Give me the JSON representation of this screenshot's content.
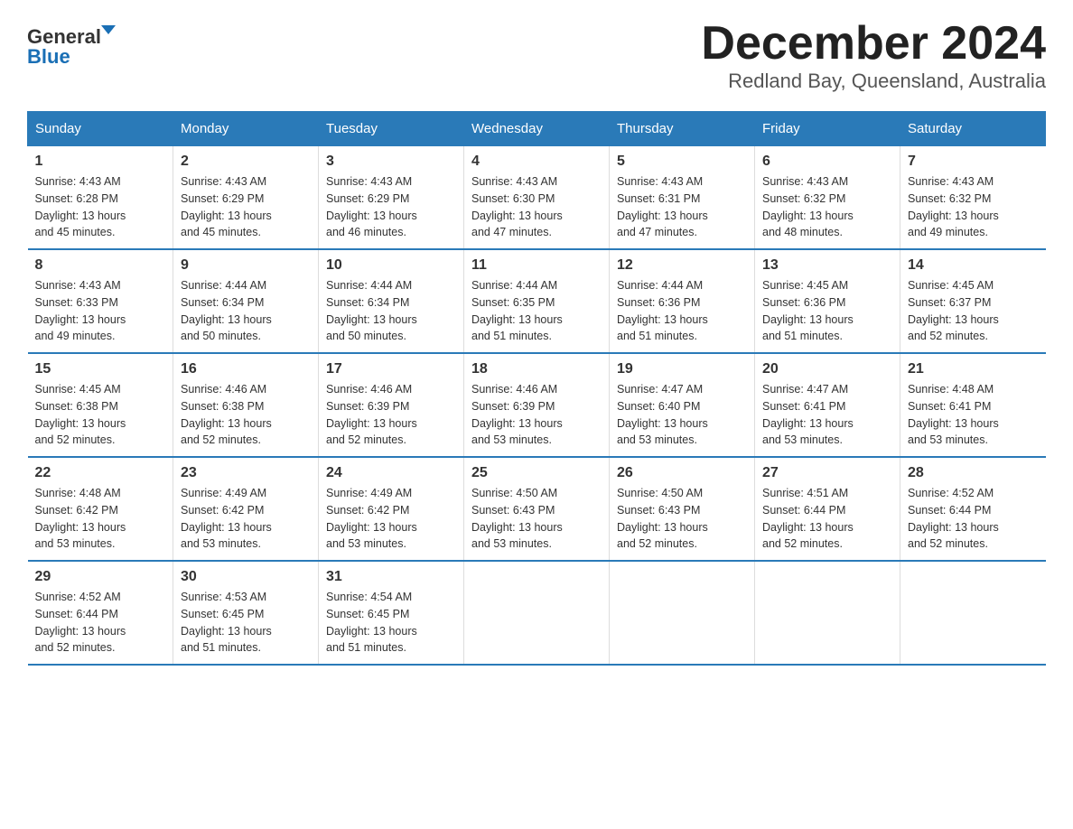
{
  "logo": {
    "general": "General",
    "blue": "Blue"
  },
  "title": "December 2024",
  "subtitle": "Redland Bay, Queensland, Australia",
  "headers": [
    "Sunday",
    "Monday",
    "Tuesday",
    "Wednesday",
    "Thursday",
    "Friday",
    "Saturday"
  ],
  "weeks": [
    [
      {
        "day": "1",
        "sunrise": "4:43 AM",
        "sunset": "6:28 PM",
        "daylight": "13 hours and 45 minutes."
      },
      {
        "day": "2",
        "sunrise": "4:43 AM",
        "sunset": "6:29 PM",
        "daylight": "13 hours and 45 minutes."
      },
      {
        "day": "3",
        "sunrise": "4:43 AM",
        "sunset": "6:29 PM",
        "daylight": "13 hours and 46 minutes."
      },
      {
        "day": "4",
        "sunrise": "4:43 AM",
        "sunset": "6:30 PM",
        "daylight": "13 hours and 47 minutes."
      },
      {
        "day": "5",
        "sunrise": "4:43 AM",
        "sunset": "6:31 PM",
        "daylight": "13 hours and 47 minutes."
      },
      {
        "day": "6",
        "sunrise": "4:43 AM",
        "sunset": "6:32 PM",
        "daylight": "13 hours and 48 minutes."
      },
      {
        "day": "7",
        "sunrise": "4:43 AM",
        "sunset": "6:32 PM",
        "daylight": "13 hours and 49 minutes."
      }
    ],
    [
      {
        "day": "8",
        "sunrise": "4:43 AM",
        "sunset": "6:33 PM",
        "daylight": "13 hours and 49 minutes."
      },
      {
        "day": "9",
        "sunrise": "4:44 AM",
        "sunset": "6:34 PM",
        "daylight": "13 hours and 50 minutes."
      },
      {
        "day": "10",
        "sunrise": "4:44 AM",
        "sunset": "6:34 PM",
        "daylight": "13 hours and 50 minutes."
      },
      {
        "day": "11",
        "sunrise": "4:44 AM",
        "sunset": "6:35 PM",
        "daylight": "13 hours and 51 minutes."
      },
      {
        "day": "12",
        "sunrise": "4:44 AM",
        "sunset": "6:36 PM",
        "daylight": "13 hours and 51 minutes."
      },
      {
        "day": "13",
        "sunrise": "4:45 AM",
        "sunset": "6:36 PM",
        "daylight": "13 hours and 51 minutes."
      },
      {
        "day": "14",
        "sunrise": "4:45 AM",
        "sunset": "6:37 PM",
        "daylight": "13 hours and 52 minutes."
      }
    ],
    [
      {
        "day": "15",
        "sunrise": "4:45 AM",
        "sunset": "6:38 PM",
        "daylight": "13 hours and 52 minutes."
      },
      {
        "day": "16",
        "sunrise": "4:46 AM",
        "sunset": "6:38 PM",
        "daylight": "13 hours and 52 minutes."
      },
      {
        "day": "17",
        "sunrise": "4:46 AM",
        "sunset": "6:39 PM",
        "daylight": "13 hours and 52 minutes."
      },
      {
        "day": "18",
        "sunrise": "4:46 AM",
        "sunset": "6:39 PM",
        "daylight": "13 hours and 53 minutes."
      },
      {
        "day": "19",
        "sunrise": "4:47 AM",
        "sunset": "6:40 PM",
        "daylight": "13 hours and 53 minutes."
      },
      {
        "day": "20",
        "sunrise": "4:47 AM",
        "sunset": "6:41 PM",
        "daylight": "13 hours and 53 minutes."
      },
      {
        "day": "21",
        "sunrise": "4:48 AM",
        "sunset": "6:41 PM",
        "daylight": "13 hours and 53 minutes."
      }
    ],
    [
      {
        "day": "22",
        "sunrise": "4:48 AM",
        "sunset": "6:42 PM",
        "daylight": "13 hours and 53 minutes."
      },
      {
        "day": "23",
        "sunrise": "4:49 AM",
        "sunset": "6:42 PM",
        "daylight": "13 hours and 53 minutes."
      },
      {
        "day": "24",
        "sunrise": "4:49 AM",
        "sunset": "6:42 PM",
        "daylight": "13 hours and 53 minutes."
      },
      {
        "day": "25",
        "sunrise": "4:50 AM",
        "sunset": "6:43 PM",
        "daylight": "13 hours and 53 minutes."
      },
      {
        "day": "26",
        "sunrise": "4:50 AM",
        "sunset": "6:43 PM",
        "daylight": "13 hours and 52 minutes."
      },
      {
        "day": "27",
        "sunrise": "4:51 AM",
        "sunset": "6:44 PM",
        "daylight": "13 hours and 52 minutes."
      },
      {
        "day": "28",
        "sunrise": "4:52 AM",
        "sunset": "6:44 PM",
        "daylight": "13 hours and 52 minutes."
      }
    ],
    [
      {
        "day": "29",
        "sunrise": "4:52 AM",
        "sunset": "6:44 PM",
        "daylight": "13 hours and 52 minutes."
      },
      {
        "day": "30",
        "sunrise": "4:53 AM",
        "sunset": "6:45 PM",
        "daylight": "13 hours and 51 minutes."
      },
      {
        "day": "31",
        "sunrise": "4:54 AM",
        "sunset": "6:45 PM",
        "daylight": "13 hours and 51 minutes."
      },
      null,
      null,
      null,
      null
    ]
  ],
  "labels": {
    "sunrise": "Sunrise:",
    "sunset": "Sunset:",
    "daylight": "Daylight:"
  }
}
